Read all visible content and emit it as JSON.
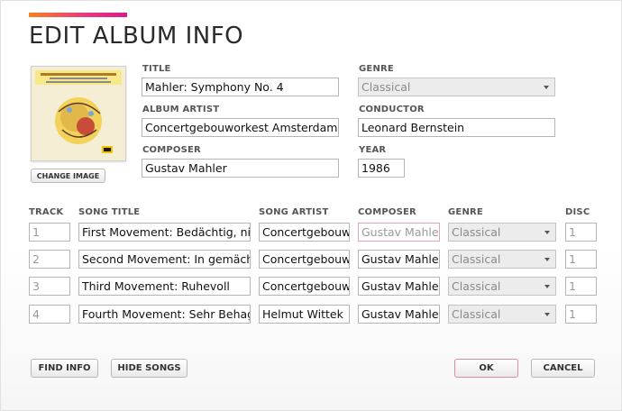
{
  "dialog": {
    "title": "EDIT ALBUM INFO",
    "accent_colors": [
      "#f58220",
      "#ec3a7a",
      "#d81b8c"
    ]
  },
  "album": {
    "art_icon": "album-cover-image",
    "change_image_label": "CHANGE IMAGE",
    "title_label": "TITLE",
    "title_value": "Mahler: Symphony No. 4",
    "genre_label": "GENRE",
    "genre_value": "Classical",
    "album_artist_label": "ALBUM ARTIST",
    "album_artist_value": "Concertgebouworkest Amsterdam",
    "conductor_label": "CONDUCTOR",
    "conductor_value": "Leonard Bernstein",
    "composer_label": "COMPOSER",
    "composer_value": "Gustav Mahler",
    "year_label": "YEAR",
    "year_value": "1986"
  },
  "tracks": {
    "headers": {
      "track": "TRACK",
      "song_title": "SONG TITLE",
      "song_artist": "SONG ARTIST",
      "composer": "COMPOSER",
      "genre": "GENRE",
      "disc": "DISC"
    },
    "rows": [
      {
        "track": "1",
        "title": "First Movement: Bedächtig, nic",
        "artist": "Concertgebouw",
        "composer": "Gustav Mahle",
        "genre": "Classical",
        "disc": "1"
      },
      {
        "track": "2",
        "title": "Second Movement: In gemäch",
        "artist": "Concertgebouw",
        "composer": "Gustav Mahle",
        "genre": "Classical",
        "disc": "1"
      },
      {
        "track": "3",
        "title": "Third Movement: Ruhevoll",
        "artist": "Concertgebouw",
        "composer": "Gustav Mahle",
        "genre": "Classical",
        "disc": "1"
      },
      {
        "track": "4",
        "title": "Fourth Movement: Sehr Behag",
        "artist": "Helmut Wittek",
        "composer": "Gustav Mahle",
        "genre": "Classical",
        "disc": "1"
      }
    ]
  },
  "buttons": {
    "find_info": "FIND INFO",
    "hide_songs": "HIDE SONGS",
    "ok": "OK",
    "cancel": "CANCEL"
  }
}
